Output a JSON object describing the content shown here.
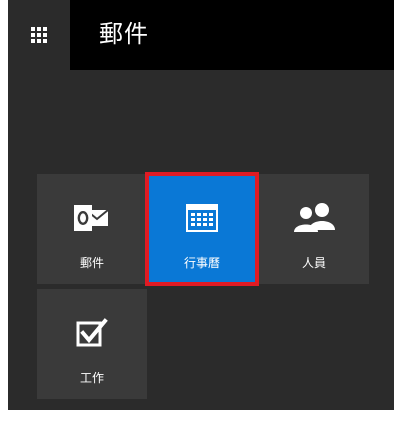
{
  "header": {
    "app_title": "郵件",
    "launcher_icon": "waffle-grid-icon"
  },
  "tiles": [
    {
      "label": "郵件",
      "icon": "outlook-mail-icon",
      "selected": false
    },
    {
      "label": "行事曆",
      "icon": "calendar-icon",
      "selected": true
    },
    {
      "label": "人員",
      "icon": "people-icon",
      "selected": false
    },
    {
      "label": "工作",
      "icon": "checkbox-task-icon",
      "selected": false
    }
  ],
  "colors": {
    "header_bg": "#000000",
    "panel_bg": "#2b2b2b",
    "tile_bg": "#3a3a3a",
    "selected_tile_bg": "#0a78d6",
    "highlight_border": "#e01b24",
    "text": "#ffffff"
  }
}
